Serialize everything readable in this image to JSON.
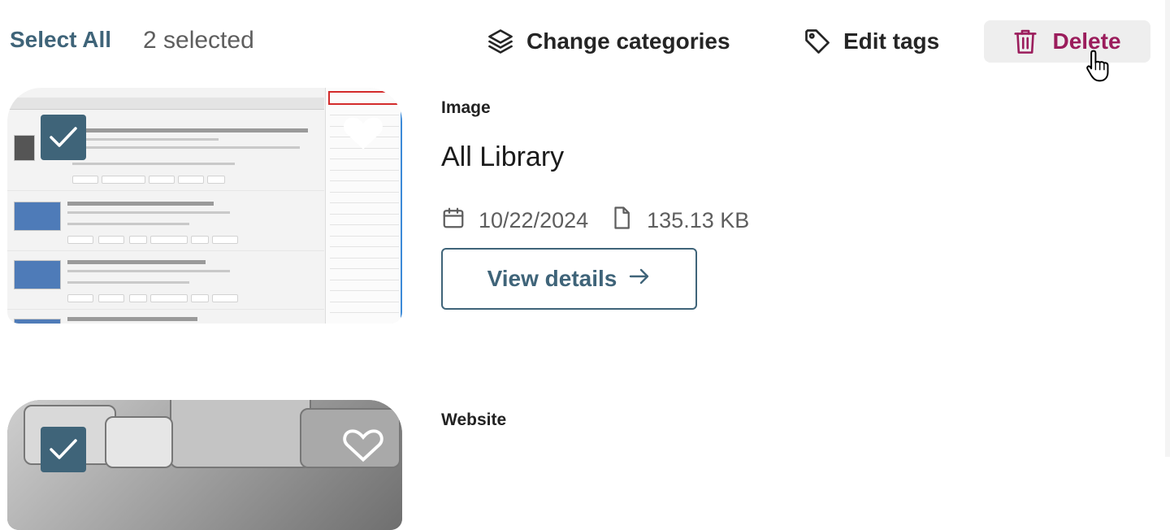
{
  "toolbar": {
    "select_all_label": "Select All",
    "selected_count": "2 selected",
    "change_categories_label": "Change categories",
    "edit_tags_label": "Edit tags",
    "delete_label": "Delete"
  },
  "resources": [
    {
      "type": "Image",
      "title": "All Library",
      "date": "10/22/2024",
      "size": "135.13 KB",
      "action_label": "View details",
      "selected": true,
      "favorited": true
    },
    {
      "type": "Website",
      "selected": true,
      "favorited": false
    }
  ],
  "colors": {
    "accent": "#3f6479",
    "delete": "#9b1d5c",
    "delete_bg": "#eeeeee"
  },
  "icons": {
    "change_categories": "layers-icon",
    "edit_tags": "tag-icon",
    "delete": "trash-icon",
    "date": "calendar-icon",
    "size": "file-icon",
    "view_details": "arrow-right-icon",
    "selected": "checkmark-icon",
    "favorite": "heart-icon"
  }
}
